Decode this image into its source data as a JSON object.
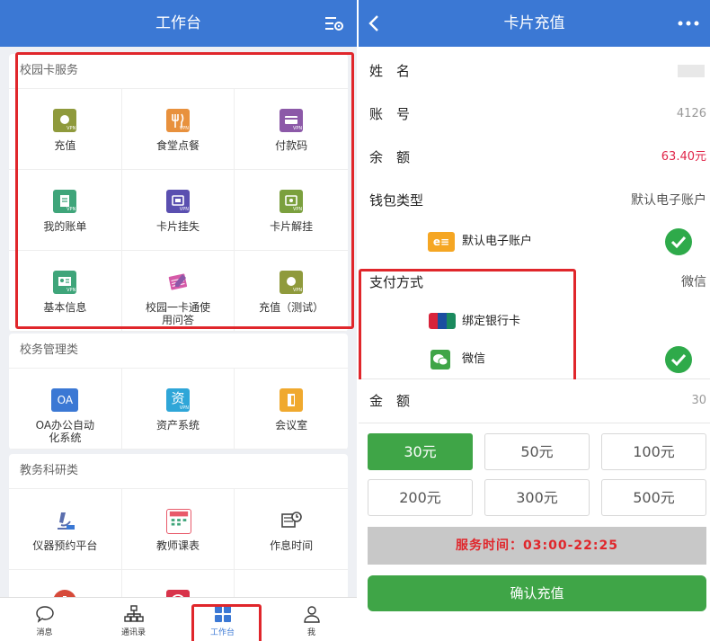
{
  "left": {
    "header": {
      "title": "工作台",
      "menu_icon": "list-settings-icon"
    },
    "sections": [
      {
        "title": "校园卡服务",
        "items": [
          {
            "label": "充值",
            "icon": "wallet-icon",
            "color": "#8f9a3c"
          },
          {
            "label": "食堂点餐",
            "icon": "dining-icon",
            "color": "#e8913d"
          },
          {
            "label": "付款码",
            "icon": "card-icon",
            "color": "#8c59a8"
          },
          {
            "label": "我的账单",
            "icon": "bill-icon",
            "color": "#3fa57a"
          },
          {
            "label": "卡片挂失",
            "icon": "card-lost-icon",
            "color": "#5a4fb0"
          },
          {
            "label": "卡片解挂",
            "icon": "card-unlock-icon",
            "color": "#7ba03e"
          },
          {
            "label": "基本信息",
            "icon": "profile-icon",
            "color": "#3fa57a"
          },
          {
            "label": "校园一卡通使用问答",
            "icon": "notebook-icon",
            "color": "#d65aa8"
          },
          {
            "label": "充值（测试）",
            "icon": "wallet-icon",
            "color": "#8f9a3c"
          }
        ]
      },
      {
        "title": "校务管理类",
        "items": [
          {
            "label": "OA办公自动化系统",
            "icon": "oa-icon",
            "color": "#3b78d4",
            "text": "OA"
          },
          {
            "label": "资产系统",
            "icon": "asset-icon",
            "color": "#2fa6d8",
            "text": "资"
          },
          {
            "label": "会议室",
            "icon": "meeting-room-icon",
            "color": "#f0a92e"
          }
        ]
      },
      {
        "title": "教务科研类",
        "items": [
          {
            "label": "仪器预约平台",
            "icon": "microscope-icon",
            "color": "#5b6fae"
          },
          {
            "label": "教师课表",
            "icon": "calendar-icon",
            "color": "#e85a6a"
          },
          {
            "label": "作息时间",
            "icon": "schedule-icon",
            "color": "#444444"
          },
          {
            "label": "",
            "icon": "hospital-icon",
            "color": "#d64a3a"
          },
          {
            "label": "",
            "icon": "finance-icon",
            "color": "#d8334a"
          },
          {
            "label": "",
            "icon": "blank",
            "color": "#ffffff"
          }
        ]
      }
    ],
    "vpn_text": "VPN",
    "tabs": [
      {
        "label": "消息",
        "icon": "chat-bubble-icon"
      },
      {
        "label": "通讯录",
        "icon": "org-chart-icon"
      },
      {
        "label": "工作台",
        "icon": "grid-icon",
        "active": true
      },
      {
        "label": "我",
        "icon": "person-icon"
      }
    ]
  },
  "right": {
    "header": {
      "title": "卡片充值",
      "back_icon": "back-arrow-icon",
      "more_icon": "more-dots-icon"
    },
    "rows": {
      "name": {
        "label": "姓　名",
        "value": ""
      },
      "account": {
        "label": "账　号",
        "value": "4126"
      },
      "balance": {
        "label": "余　额",
        "value": "63.40元"
      },
      "wallet_type": {
        "label": "钱包类型",
        "value": "默认电子账户"
      },
      "wallet_option": {
        "label": "默认电子账户",
        "icon_text": "e≡"
      },
      "pay_method": {
        "label": "支付方式",
        "value": "微信"
      },
      "bank_option": {
        "label": "绑定银行卡"
      },
      "wechat_option": {
        "label": "微信"
      },
      "amount": {
        "label": "金　额",
        "value": "30"
      }
    },
    "amounts": [
      "30元",
      "50元",
      "100元",
      "200元",
      "300元",
      "500元"
    ],
    "selected_amount": "30元",
    "service_time": "服务时间：03:00-22:25",
    "confirm_label": "确认充值",
    "colors": {
      "primary": "#3b78d4",
      "accent_green": "#3fa547",
      "alert_red": "#e0262b"
    }
  }
}
